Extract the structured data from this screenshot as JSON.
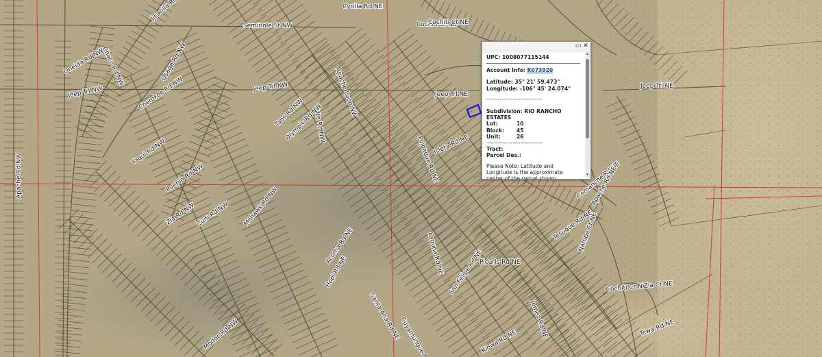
{
  "map": {
    "road_labels": [
      "Cyrilla Rd NE",
      "Cochiti Ct NE",
      "Seminole St NW",
      "Jeep Trl NW",
      "Jeep Trl NE",
      "Jeep Trl NE",
      "Jeep Trl NW",
      "Apache Rd NW",
      "Chaco Rd NW",
      "Jicarilla Rd NW",
      "Oneida Rd NW",
      "Osage Rd NW",
      "Cherokee Rd NW",
      "Taos Rd NW",
      "Ute Rd NW",
      "Olympic Rd NW",
      "Yaqui Rd NW",
      "Pueblo Rd NW",
      "Zia Rd NW",
      "Zuni Rd NW",
      "Apache Loop NW",
      "Mohawk Rd NW",
      "Comanche Rd NE",
      "Isleta Rd NE",
      "Sandia Rd NE",
      "Cochiti Ct NE",
      "Apache Rd NE",
      "Nambe Ct NE",
      "Tesuque Rd NE",
      "Picuris Rd NE",
      "Jemez Rd NE",
      "Laguna Rd NE",
      "Acoma Rd NE",
      "Santa Ana Rd NE",
      "Pojoaque Rd NE",
      "Hopi Rd NE",
      "Cochiti Ct NE",
      "Zia Ct NE",
      "San Felipe Rd NE",
      "Cuyamungue Rd NE",
      "Tewa Rd NE",
      "Kiowa Rd NE",
      "Modoc Rd NW"
    ]
  },
  "popup": {
    "upc_label": "UPC:",
    "upc_value": "1008077115144",
    "account_label": "Account Info:",
    "account_link": "R073920",
    "latitude_label": "Latitude:",
    "latitude_value": "35° 21' 59.473\"",
    "longitude_label": "Longitude:",
    "longitude_value": "-106° 45' 24.074\"",
    "separator": "------------------------------",
    "subdivision_label": "Subdivision:",
    "subdivision_value": "RIO RANCHO ESTATES",
    "lot_label": "Lot:",
    "lot_value": "10",
    "block_label": "Block:",
    "block_value": "45",
    "unit_label": "Unit:",
    "unit_value": "26",
    "tract_label": "Tract:",
    "parcel_label": "Parcel Des.:",
    "note": "Please Note: Latitude and Longitude is the approximate center of the parcel shown.",
    "maximize_icon": "maximize-icon",
    "close_icon": "close-icon"
  },
  "colors": {
    "terrain": "#b5a889",
    "parcel_line": "#3a3428",
    "section_line": "#d23a2c",
    "selected_parcel": "#1c19d6"
  }
}
